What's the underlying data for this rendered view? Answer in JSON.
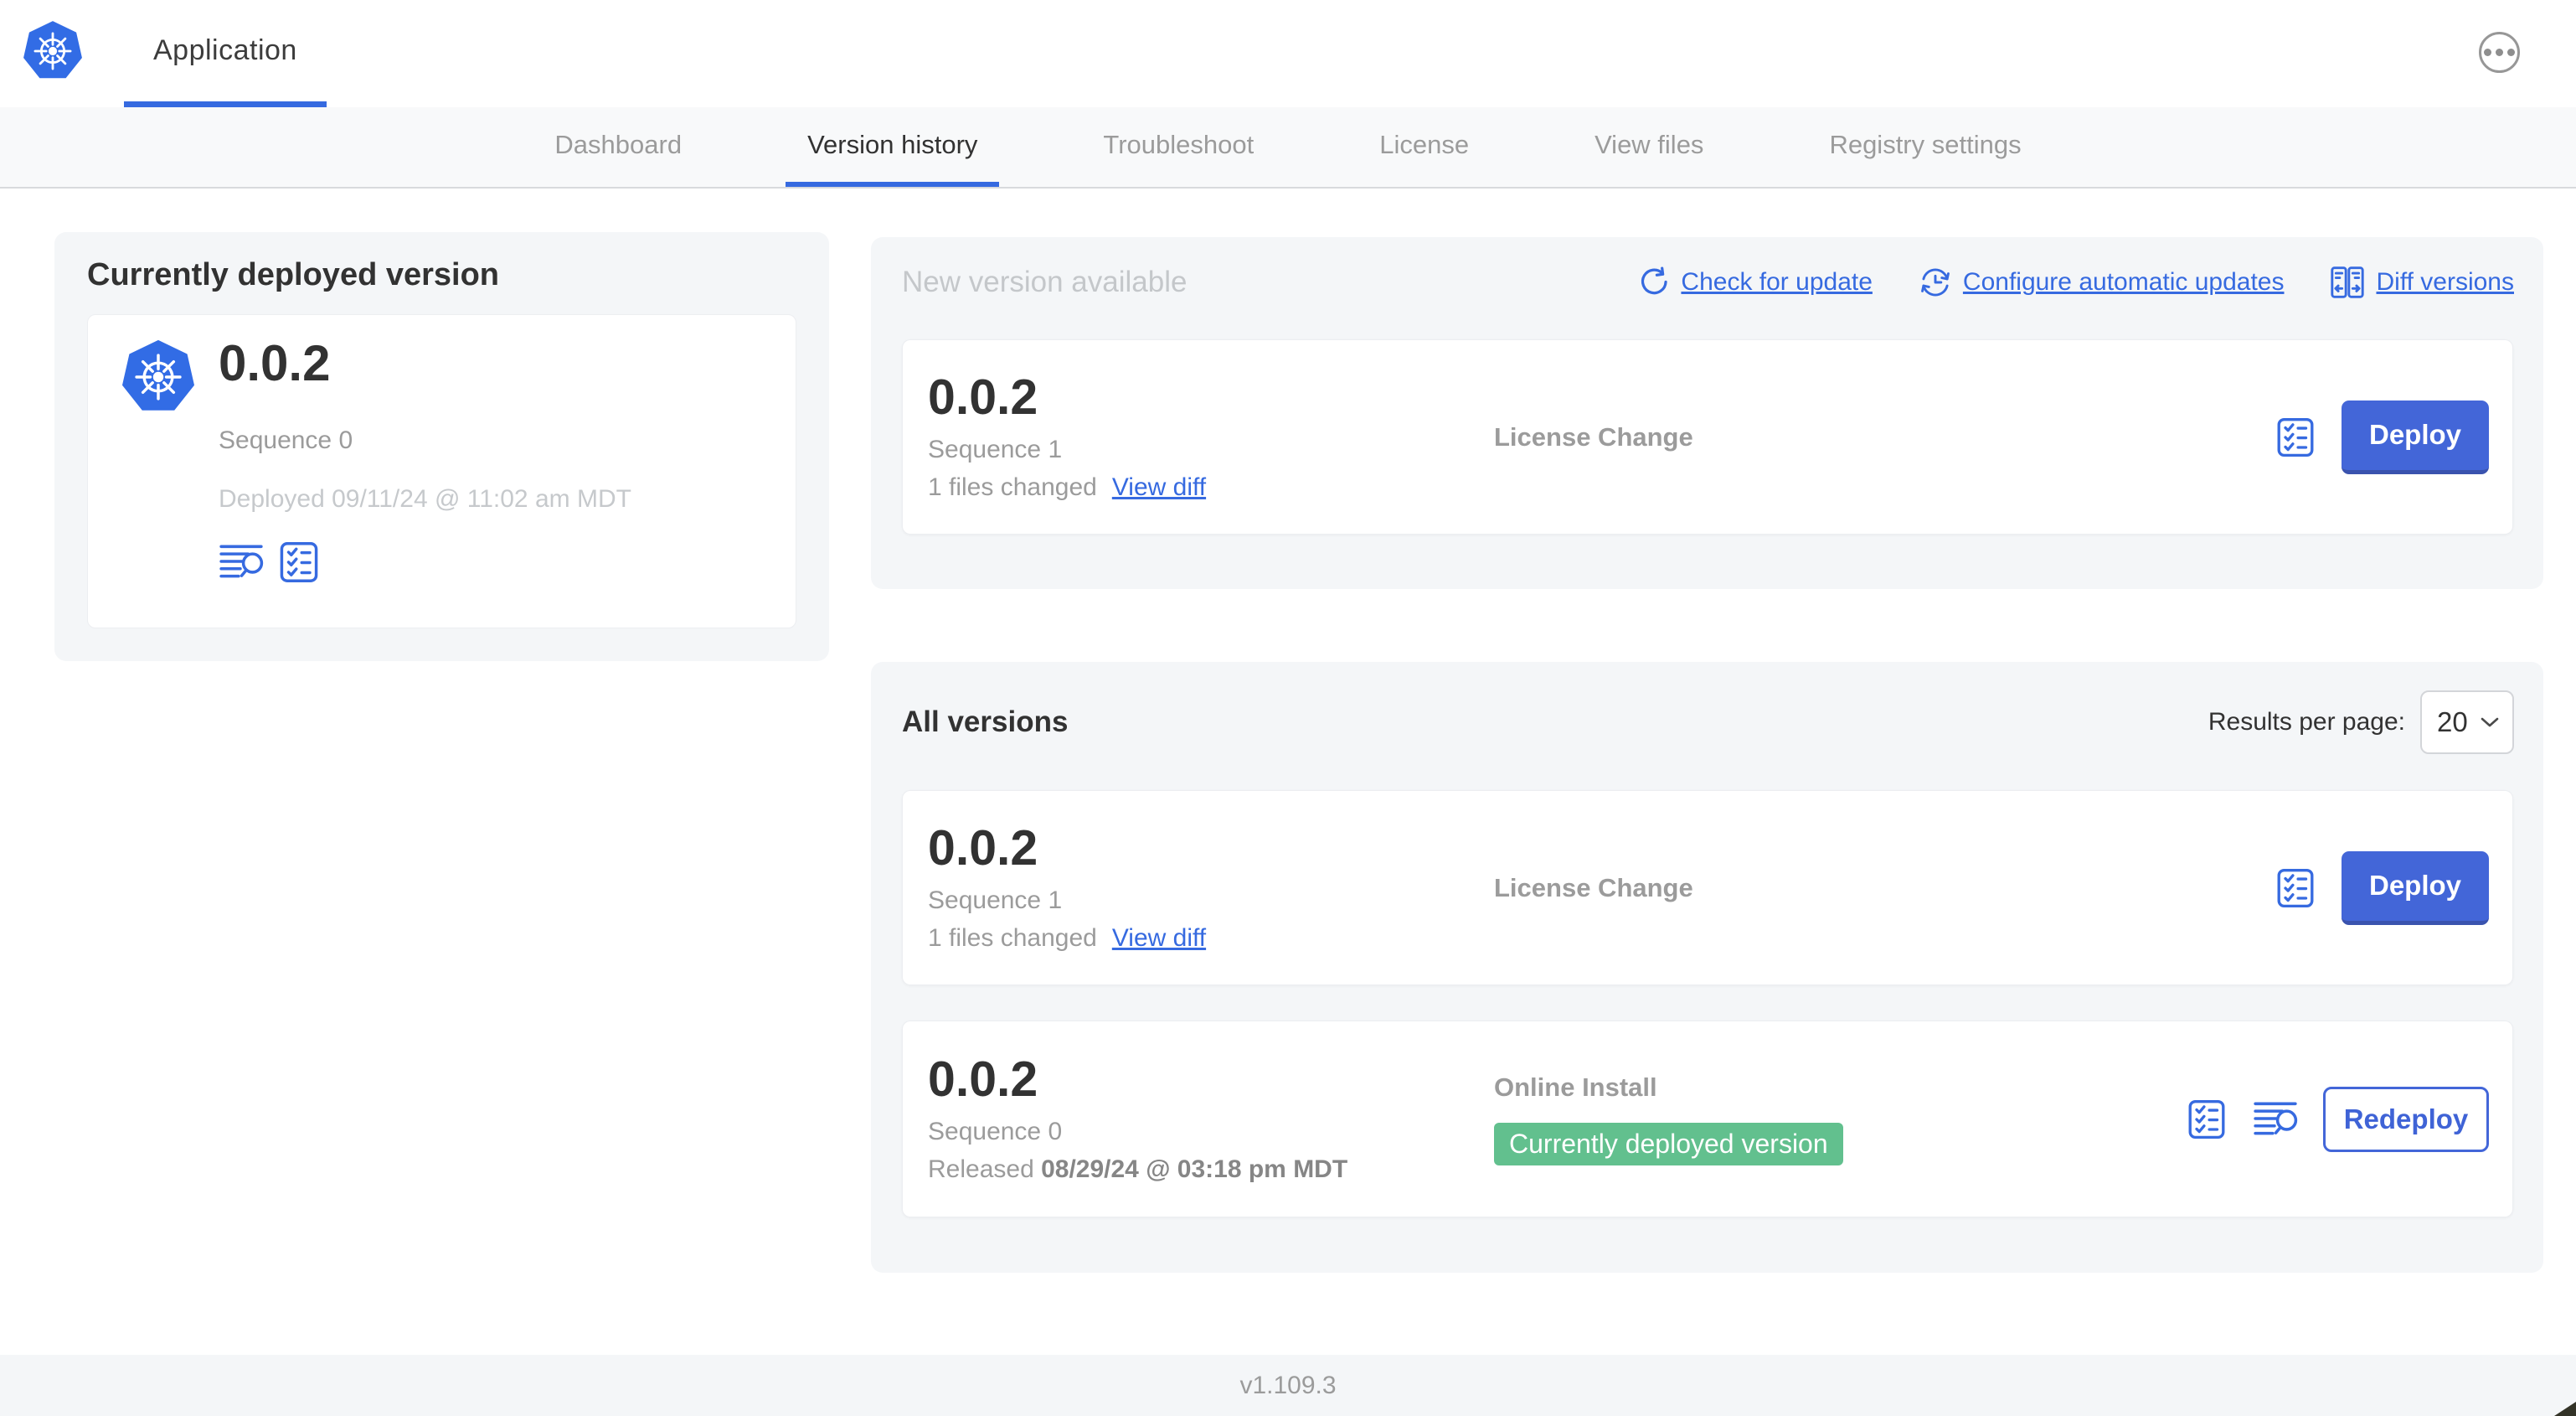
{
  "colors": {
    "accent_blue": "#366ae0",
    "button_blue": "#4366d8",
    "kubernetes_blue": "#326ce5",
    "badge_green": "#62c08e",
    "text_dark": "#323232",
    "text_gray": "#9b9b9b",
    "text_light_gray": "#c6c9cc",
    "section_bg": "#f4f6f8"
  },
  "header": {
    "app_title": "Application"
  },
  "nav": {
    "tabs": [
      {
        "label": "Dashboard",
        "active": false
      },
      {
        "label": "Version history",
        "active": true
      },
      {
        "label": "Troubleshoot",
        "active": false
      },
      {
        "label": "License",
        "active": false
      },
      {
        "label": "View files",
        "active": false
      },
      {
        "label": "Registry settings",
        "active": false
      }
    ]
  },
  "current_version": {
    "section_title": "Currently deployed version",
    "version": "0.0.2",
    "sequence": "Sequence 0",
    "deployed": "Deployed 09/11/24 @ 11:02 am MDT"
  },
  "new_version": {
    "section_title": "New version available",
    "check_for_update": "Check for update",
    "configure_updates": "Configure automatic updates",
    "diff_versions": "Diff versions",
    "row": {
      "version": "0.0.2",
      "sequence": "Sequence 1",
      "files_changed": "1 files changed",
      "view_diff": "View diff",
      "source": "License Change",
      "deploy": "Deploy"
    }
  },
  "all_versions": {
    "section_title": "All versions",
    "results_per_page_label": "Results per page:",
    "results_per_page_value": "20",
    "rows": [
      {
        "version": "0.0.2",
        "sequence": "Sequence 1",
        "files_changed": "1 files changed",
        "view_diff": "View diff",
        "source": "License Change",
        "deploy": "Deploy"
      },
      {
        "version": "0.0.2",
        "sequence": "Sequence 0",
        "released_label": "Released ",
        "released_date": "08/29/24 @ 03:18 pm MDT",
        "source": "Online Install",
        "badge": "Currently deployed version",
        "redeploy": "Redeploy"
      }
    ]
  },
  "footer": {
    "app_version": "v1.109.3"
  }
}
